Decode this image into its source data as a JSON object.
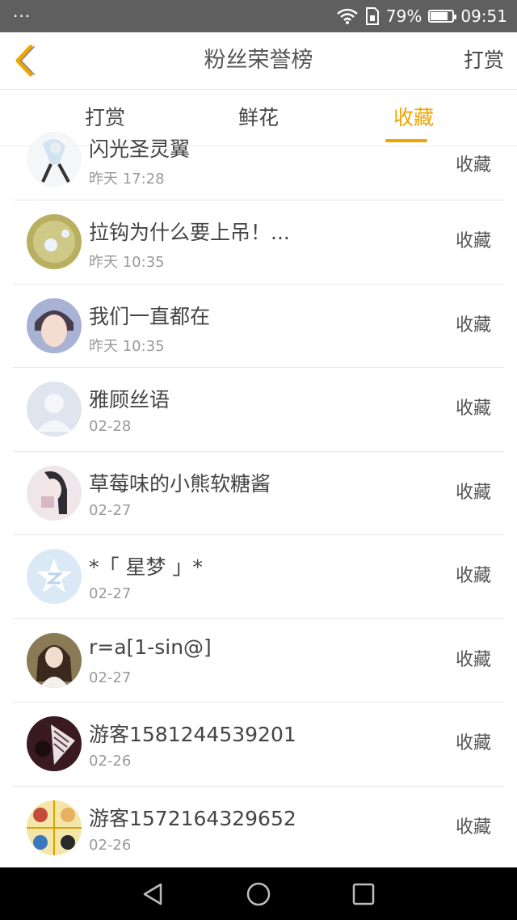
{
  "status_bar": {
    "dots": "···",
    "battery_percent": "79%",
    "time": "09:51",
    "battery_level": 0.79
  },
  "header": {
    "title": "粉丝荣誉榜",
    "right_action": "打赏"
  },
  "tabs": [
    {
      "label": "打赏",
      "active": false
    },
    {
      "label": "鲜花",
      "active": false
    },
    {
      "label": "收藏",
      "active": true
    }
  ],
  "accent_color": "#f0a500",
  "list": [
    {
      "name": "闪光圣灵翼",
      "time": "昨天 17:28",
      "action": "收藏"
    },
    {
      "name": "拉钩为什么要上吊！...",
      "time": "昨天 10:35",
      "action": "收藏"
    },
    {
      "name": "我们一直都在",
      "time": "昨天 10:35",
      "action": "收藏"
    },
    {
      "name": "雅顾丝语",
      "time": "02-28",
      "action": "收藏"
    },
    {
      "name": "草莓味的小熊软糖酱",
      "time": "02-27",
      "action": "收藏"
    },
    {
      "name": "*「 星梦 」*",
      "time": "02-27",
      "action": "收藏"
    },
    {
      "name": "r=a[1-sin@]",
      "time": "02-27",
      "action": "收藏"
    },
    {
      "name": "游客1581244539201",
      "time": "02-26",
      "action": "收藏"
    },
    {
      "name": "游客1572164329652",
      "time": "02-26",
      "action": "收藏"
    }
  ],
  "nav": {
    "icons": [
      "back-triangle-icon",
      "home-circle-icon",
      "recent-square-icon"
    ]
  }
}
